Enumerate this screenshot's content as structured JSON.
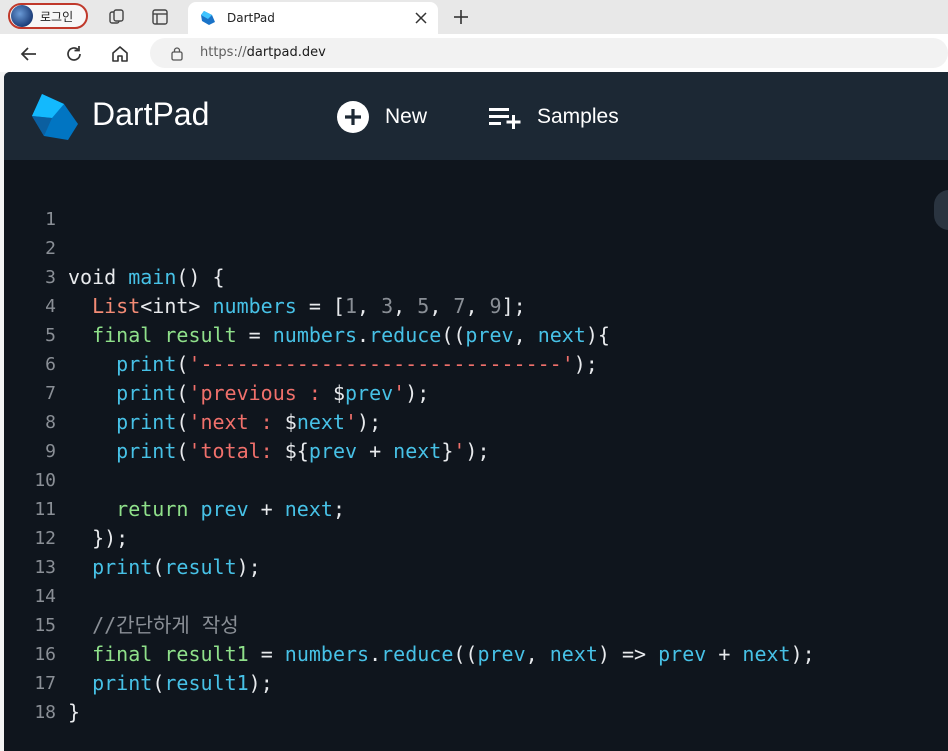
{
  "browser": {
    "profile_label": "로그인",
    "tab_title": "DartPad",
    "url_prefix": "https://",
    "url_domain": "dartpad.dev"
  },
  "app": {
    "brand": "DartPad",
    "new_label": "New",
    "samples_label": "Samples"
  },
  "colors": {
    "keyword": "#8fe08a",
    "identifier": "#47c1e6",
    "string": "#f0706b",
    "type": "#f38b75",
    "background": "#0f151d",
    "header": "#1c2834"
  },
  "editor": {
    "line_numbers": [
      "1",
      "2",
      "3",
      "4",
      "5",
      "6",
      "7",
      "8",
      "9",
      "10",
      "11",
      "12",
      "13",
      "14",
      "15",
      "16",
      "17",
      "18"
    ],
    "lines": {
      "l2": [
        "void ",
        "main",
        "() {"
      ],
      "l3": [
        "  ",
        "List",
        "<int> ",
        "numbers",
        " = [",
        "1",
        ", ",
        "3",
        ", ",
        "5",
        ", ",
        "7",
        ", ",
        "9",
        "];"
      ],
      "l4": [
        "  ",
        "final",
        " ",
        "result",
        " = ",
        "numbers",
        ".",
        "reduce",
        "((",
        "prev",
        ", ",
        "next",
        "){"
      ],
      "l5": [
        "    ",
        "print",
        "(",
        "'------------------------------'",
        ");"
      ],
      "l6": [
        "    ",
        "print",
        "(",
        "'previous : ",
        "$",
        "prev",
        "'",
        ");"
      ],
      "l7": [
        "    ",
        "print",
        "(",
        "'next : ",
        "$",
        "next",
        "'",
        ");"
      ],
      "l8": [
        "    ",
        "print",
        "(",
        "'total: ",
        "${",
        "prev",
        " + ",
        "next",
        "}",
        "'",
        ");"
      ],
      "l10": [
        "    ",
        "return",
        " ",
        "prev",
        " + ",
        "next",
        ";"
      ],
      "l11": [
        "  });"
      ],
      "l12": [
        "  ",
        "print",
        "(",
        "result",
        ");"
      ],
      "l14": [
        "  ",
        "//간단하게 작성"
      ],
      "l15": [
        "  ",
        "final",
        " ",
        "result1",
        " = ",
        "numbers",
        ".",
        "reduce",
        "((",
        "prev",
        ", ",
        "next",
        ") => ",
        "prev",
        " + ",
        "next",
        ");"
      ],
      "l16": [
        "  ",
        "print",
        "(",
        "result1",
        ");"
      ],
      "l17": [
        "}"
      ]
    }
  }
}
